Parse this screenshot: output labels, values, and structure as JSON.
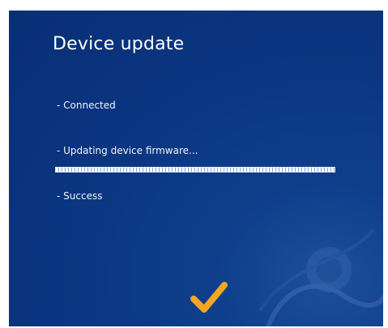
{
  "dialog": {
    "title": "Device update",
    "steps": [
      {
        "label": "- Connected"
      },
      {
        "label": "- Updating device firmware..."
      },
      {
        "label": "- Success"
      }
    ],
    "progress_fraction": 1.0,
    "status_icon": "checkmark-icon",
    "background_icon": "device-illustration-icon"
  },
  "colors": {
    "background": "#0b3681",
    "text": "#ffffff",
    "checkmark": "#f6a623"
  }
}
